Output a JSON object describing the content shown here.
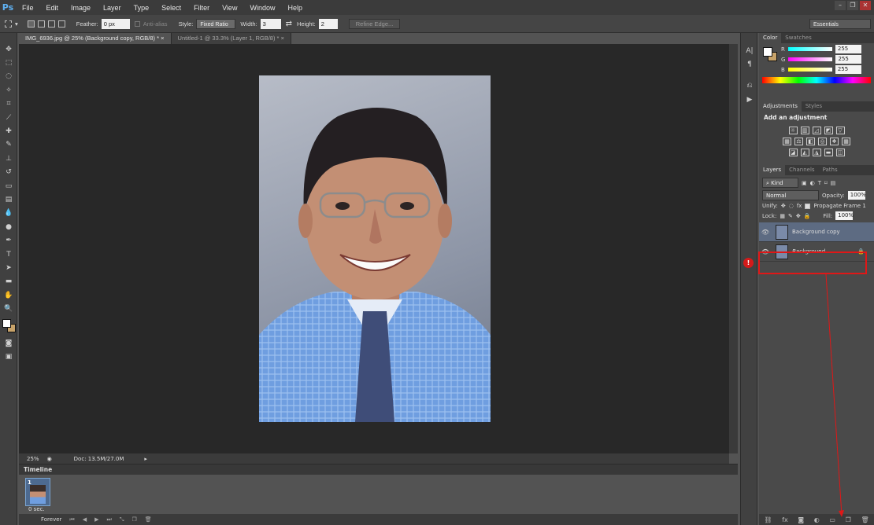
{
  "menubar": {
    "logo": "Ps",
    "items": [
      "File",
      "Edit",
      "Image",
      "Layer",
      "Type",
      "Select",
      "Filter",
      "View",
      "Window",
      "Help"
    ]
  },
  "options_bar": {
    "feather_label": "Feather:",
    "feather_value": "0 px",
    "antialias_label": "Anti-alias",
    "style_label": "Style:",
    "style_value": "Fixed Ratio",
    "width_label": "Width:",
    "width_value": "3",
    "height_label": "Height:",
    "height_value": "2",
    "refine_label": "Refine Edge...",
    "workspace_value": "Essentials"
  },
  "doc_tabs": [
    {
      "label": "IMG_6936.jpg @ 25% (Background copy, RGB/8) *"
    },
    {
      "label": "Untitled-1 @ 33.3% (Layer 1, RGB/8) *"
    }
  ],
  "status": {
    "zoom": "25%",
    "doc": "Doc: 13.5M/27.0M"
  },
  "timeline": {
    "title": "Timeline",
    "frame_number": "1",
    "frame_delay": "0 sec.",
    "loop": "Forever"
  },
  "color_panel": {
    "tabs": [
      "Color",
      "Swatches"
    ],
    "r_label": "R",
    "g_label": "G",
    "b_label": "B",
    "r": "255",
    "g": "255",
    "b": "255"
  },
  "adjustments": {
    "tabs": [
      "Adjustments",
      "Styles"
    ],
    "heading": "Add an adjustment"
  },
  "layers": {
    "tabs": [
      "Layers",
      "Channels",
      "Paths"
    ],
    "kind": "Kind",
    "blend": "Normal",
    "opacity_label": "Opacity:",
    "opacity": "100%",
    "unify_label": "Unify:",
    "propagate_label": "Propagate Frame 1",
    "lock_label": "Lock:",
    "fill_label": "Fill:",
    "fill": "100%",
    "items": [
      {
        "name": "Background copy"
      },
      {
        "name": "Background"
      }
    ]
  },
  "annotation": {
    "marker": "!"
  },
  "colors": {
    "highlight": "#e01717",
    "accent": "#5fb0f0"
  }
}
